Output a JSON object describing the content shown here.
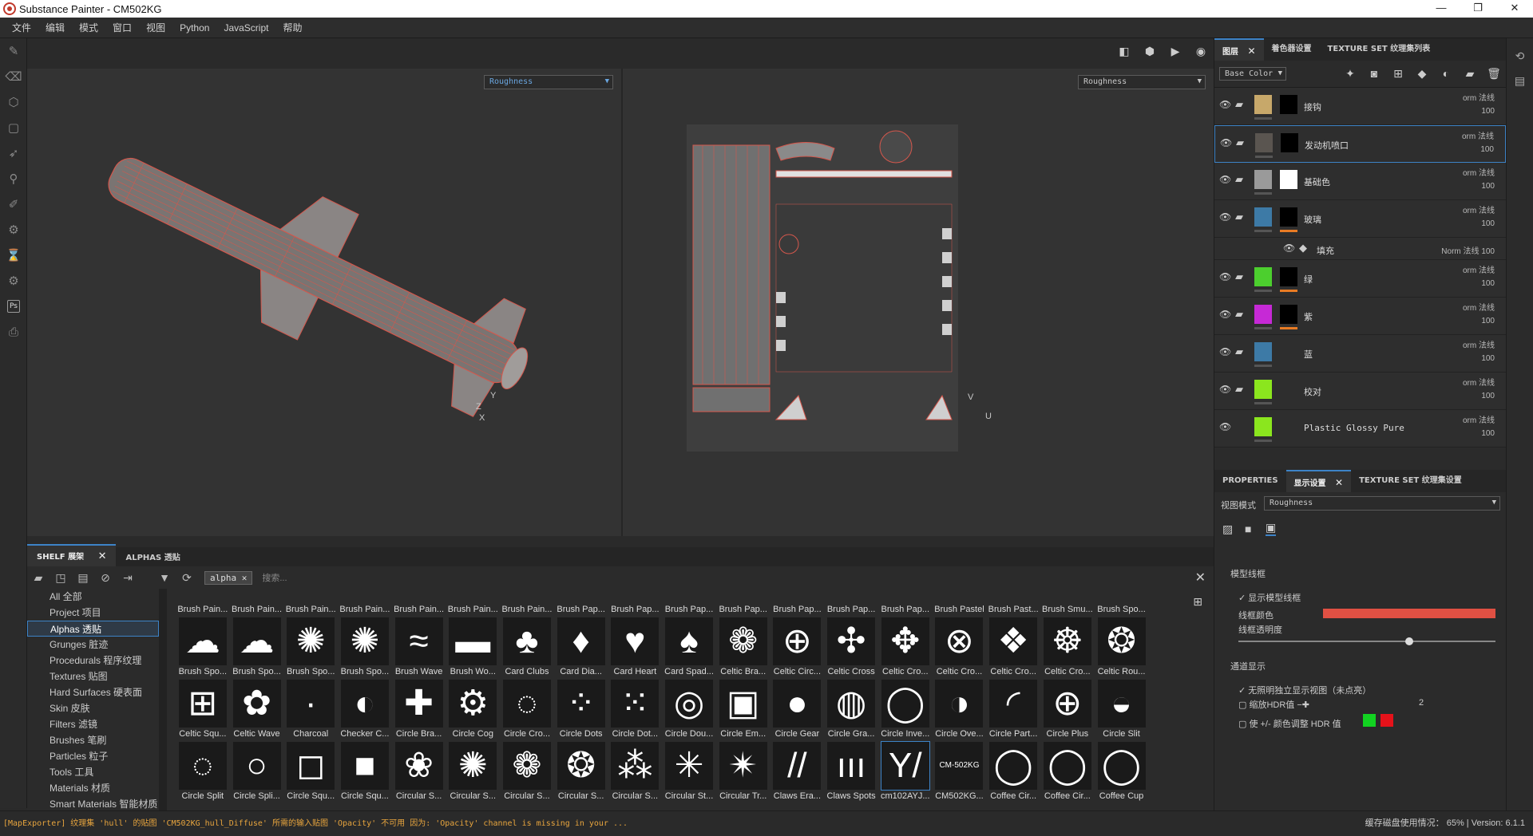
{
  "window": {
    "title": "Substance Painter - CM502KG",
    "minimize": "—",
    "maximize": "❐",
    "close": "✕"
  },
  "menu": [
    "文件",
    "编辑",
    "模式",
    "窗口",
    "视图",
    "Python",
    "JavaScript",
    "帮助"
  ],
  "viewport": {
    "left_channel": "Roughness",
    "right_channel": "Roughness",
    "axis_y": "Y",
    "axis_x": "X",
    "axis_z": "Z",
    "uv_v": "V",
    "uv_u": "U"
  },
  "shelf": {
    "tabs": [
      {
        "label": "SHELF 展架"
      },
      {
        "label": "ALPHAS 透贴"
      }
    ],
    "filter_tag": "alpha",
    "search_placeholder": "搜索...",
    "categories": [
      {
        "label": "All 全部"
      },
      {
        "label": "Project 项目"
      },
      {
        "label": "Alphas 透贴"
      },
      {
        "label": "Grunges 脏迹"
      },
      {
        "label": "Procedurals 程序纹理"
      },
      {
        "label": "Textures 贴图"
      },
      {
        "label": "Hard Surfaces 硬表面"
      },
      {
        "label": "Skin 皮肤"
      },
      {
        "label": "Filters 滤镜"
      },
      {
        "label": "Brushes 笔刷"
      },
      {
        "label": "Particles 粒子"
      },
      {
        "label": "Tools 工具"
      },
      {
        "label": "Materials 材质"
      },
      {
        "label": "Smart Materials 智能材质"
      }
    ],
    "row0": [
      "Brush Pain...",
      "Brush Pain...",
      "Brush Pain...",
      "Brush Pain...",
      "Brush Pain...",
      "Brush Pain...",
      "Brush Pain...",
      "Brush Pap...",
      "Brush Pap...",
      "Brush Pap...",
      "Brush Pap...",
      "Brush Pap...",
      "Brush Pap...",
      "Brush Pap...",
      "Brush Pastel",
      "Brush Past...",
      "Brush Smu...",
      "Brush Spo..."
    ],
    "row1": [
      {
        "label": "Brush Spo...",
        "glyph": "☁"
      },
      {
        "label": "Brush Spo...",
        "glyph": "☁"
      },
      {
        "label": "Brush Spo...",
        "glyph": "✺"
      },
      {
        "label": "Brush Spo...",
        "glyph": "✺"
      },
      {
        "label": "Brush Wave",
        "glyph": "≈"
      },
      {
        "label": "Brush Wo...",
        "glyph": "▬"
      },
      {
        "label": "Card Clubs",
        "glyph": "♣"
      },
      {
        "label": "Card Dia...",
        "glyph": "♦"
      },
      {
        "label": "Card Heart",
        "glyph": "♥"
      },
      {
        "label": "Card Spad...",
        "glyph": "♠"
      },
      {
        "label": "Celtic Bra...",
        "glyph": "❁"
      },
      {
        "label": "Celtic Circ...",
        "glyph": "⊕"
      },
      {
        "label": "Celtic Cross",
        "glyph": "✣"
      },
      {
        "label": "Celtic Cro...",
        "glyph": "✥"
      },
      {
        "label": "Celtic Cro...",
        "glyph": "⊗"
      },
      {
        "label": "Celtic Cro...",
        "glyph": "❖"
      },
      {
        "label": "Celtic Cro...",
        "glyph": "☸"
      },
      {
        "label": "Celtic Rou...",
        "glyph": "❂"
      }
    ],
    "row2": [
      {
        "label": "Celtic Squ...",
        "glyph": "⊞"
      },
      {
        "label": "Celtic Wave",
        "glyph": "✿"
      },
      {
        "label": "Charcoal",
        "glyph": "·"
      },
      {
        "label": "Checker C...",
        "glyph": "◐"
      },
      {
        "label": "Circle Bra...",
        "glyph": "✚"
      },
      {
        "label": "Circle Cog",
        "glyph": "⚙"
      },
      {
        "label": "Circle Cro...",
        "glyph": "◌"
      },
      {
        "label": "Circle Dots",
        "glyph": "⁘"
      },
      {
        "label": "Circle Dot...",
        "glyph": "⁙"
      },
      {
        "label": "Circle Dou...",
        "glyph": "◎"
      },
      {
        "label": "Circle Em...",
        "glyph": "▣"
      },
      {
        "label": "Circle Gear",
        "glyph": "●"
      },
      {
        "label": "Circle Gra...",
        "glyph": "◍"
      },
      {
        "label": "Circle Inve...",
        "glyph": "◯"
      },
      {
        "label": "Circle Ove...",
        "glyph": "◑"
      },
      {
        "label": "Circle Part...",
        "glyph": "◜"
      },
      {
        "label": "Circle Plus",
        "glyph": "⊕"
      },
      {
        "label": "Circle Slit",
        "glyph": "◒"
      }
    ],
    "row3": [
      {
        "label": "Circle Split",
        "glyph": "◌"
      },
      {
        "label": "Circle Spli...",
        "glyph": "○"
      },
      {
        "label": "Circle Squ...",
        "glyph": "◻"
      },
      {
        "label": "Circle Squ...",
        "glyph": "■"
      },
      {
        "label": "Circular S...",
        "glyph": "❀"
      },
      {
        "label": "Circular S...",
        "glyph": "✺"
      },
      {
        "label": "Circular S...",
        "glyph": "❁"
      },
      {
        "label": "Circular S...",
        "glyph": "❂"
      },
      {
        "label": "Circular S...",
        "glyph": "⁂"
      },
      {
        "label": "Circular St...",
        "glyph": "✳"
      },
      {
        "label": "Circular Tr...",
        "glyph": "✴"
      },
      {
        "label": "Claws Era...",
        "glyph": "//"
      },
      {
        "label": "Claws Spots",
        "glyph": "ııı"
      },
      {
        "label": "cm102AYJ...",
        "glyph": "Y/"
      },
      {
        "label": "CM502KG...",
        "glyph": "CM-502KG"
      },
      {
        "label": "Coffee Cir...",
        "glyph": "◯"
      },
      {
        "label": "Coffee Cir...",
        "glyph": "◯"
      },
      {
        "label": "Coffee Cup",
        "glyph": "◯"
      }
    ]
  },
  "layers_panel": {
    "tabs": [
      {
        "label": "图层"
      },
      {
        "label": "着色器设置"
      },
      {
        "label": "TEXTURE SET 纹理集列表"
      }
    ],
    "channel": "Base Color",
    "layers": [
      {
        "name": "接钩",
        "blend": "orm 法线",
        "opacity": "100",
        "thumb": "#c7a86a",
        "mask": "#000",
        "orange": false
      },
      {
        "name": "发动机喷口",
        "blend": "orm 法线",
        "opacity": "100",
        "thumb": "#5a5550",
        "mask": "#000",
        "orange": false
      },
      {
        "name": "基础色",
        "blend": "orm 法线",
        "opacity": "100",
        "thumb": "#9a9a9a",
        "mask": "#ffffff",
        "orange": false
      },
      {
        "name": "玻璃",
        "blend": "orm 法线",
        "opacity": "100",
        "thumb": "#3d7aa6",
        "mask": "#000",
        "orange": true
      },
      {
        "name": "绿",
        "blend": "orm 法线",
        "opacity": "100",
        "thumb": "#4ccf2e",
        "mask": "#000",
        "orange": true
      },
      {
        "name": "紫",
        "blend": "orm 法线",
        "opacity": "100",
        "thumb": "#c629d6",
        "mask": "#000",
        "orange": true
      },
      {
        "name": "蓝",
        "blend": "orm 法线",
        "opacity": "100",
        "thumb": "#3d7aa6",
        "mask": "",
        "orange": false
      },
      {
        "name": "校对",
        "blend": "orm 法线",
        "opacity": "100",
        "thumb": "#8be61e",
        "mask": "",
        "orange": false
      },
      {
        "name": "Plastic Glossy Pure",
        "blend": "orm 法线",
        "opacity": "100",
        "thumb": "#8be61e",
        "mask": "",
        "orange": false
      }
    ],
    "fill_layer": {
      "name": "填充",
      "blend": "Norm 法线",
      "opacity": "100"
    }
  },
  "props_panel": {
    "tabs": [
      {
        "label": "PROPERTIES"
      },
      {
        "label": "显示设置"
      },
      {
        "label": "TEXTURE SET 纹理集设置"
      }
    ],
    "view_mode_label": "视图模式",
    "view_mode_value": "Roughness",
    "wireframe_section": "模型线框",
    "show_wireframe": "显示模型线框",
    "wire_color_label": "线框颜色",
    "wire_opacity_label": "线框透明度",
    "wire_opacity": 0.65,
    "wire_color": "#e05043",
    "channel_section": "通道显示",
    "nohdr_label": "无照明独立显示视图（未点亮）",
    "hdr_scale_label": "缩放HDR值",
    "hdr_value": "2",
    "color_adjust_label": "使 +/- 颜色调整 HDR 值"
  },
  "status": {
    "message": "[MapExporter] 纹理集 'hull' 的贴图 'CM502KG_hull_Diffuse' 所需的输入贴图 'Opacity' 不可用 因为: 'Opacity' channel is missing in your ...",
    "cache": "缓存磁盘使用情况：",
    "cache_value": "65%",
    "version": "Version: 6.1.1"
  }
}
